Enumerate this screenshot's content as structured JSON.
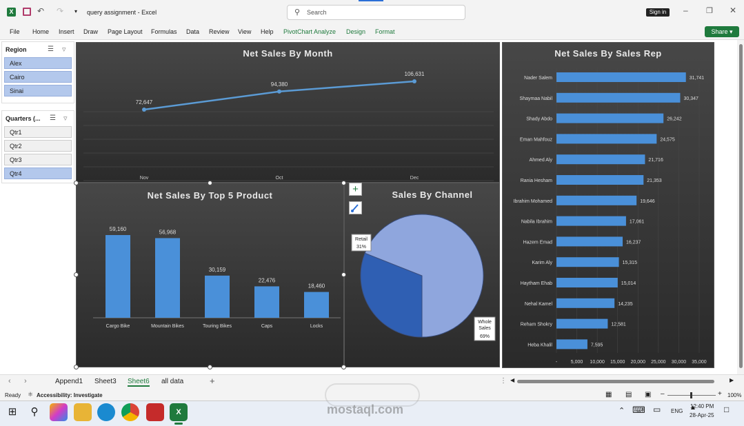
{
  "app": {
    "filename": "query assignment",
    "app_name": "Excel",
    "sep": "-",
    "search_placeholder": "Search",
    "signin": "Sign in"
  },
  "ribbon": {
    "tabs": [
      "File",
      "Home",
      "Insert",
      "Draw",
      "Page Layout",
      "Formulas",
      "Data",
      "Review",
      "View",
      "Help",
      "PivotChart Analyze",
      "Design",
      "Format"
    ],
    "share": "Share"
  },
  "slicers": {
    "region": {
      "title": "Region",
      "items": [
        {
          "label": "Alex",
          "selected": true
        },
        {
          "label": "Cairo",
          "selected": true
        },
        {
          "label": "Sinai",
          "selected": true
        }
      ]
    },
    "quarters": {
      "title": "Quarters (...",
      "items": [
        {
          "label": "Qtr1",
          "selected": false
        },
        {
          "label": "Qtr2",
          "selected": false
        },
        {
          "label": "Qtr3",
          "selected": false
        },
        {
          "label": "Qtr4",
          "selected": true
        }
      ]
    }
  },
  "charts": {
    "month": "Net Sales By Month",
    "product": "Net Sales By Top 5 Product",
    "channel": "Sales By Channel",
    "rep": "Net Sales By Sales Rep"
  },
  "chart_data": [
    {
      "type": "line",
      "title": "Net Sales By Month",
      "categories": [
        "Nov",
        "Oct",
        "Dec"
      ],
      "values": [
        72647,
        94380,
        106631
      ],
      "data_labels": [
        "72,647",
        "94,380",
        "106,631"
      ],
      "color": "#5b9bd5"
    },
    {
      "type": "bar",
      "title": "Net Sales By Top 5 Product",
      "categories": [
        "Cargo Bike",
        "Mountain Bikes",
        "Touring Bikes",
        "Caps",
        "Locks"
      ],
      "values": [
        59160,
        56968,
        30159,
        22476,
        18460
      ],
      "data_labels": [
        "59,160",
        "56,968",
        "30,159",
        "22,476",
        "18,460"
      ],
      "color": "#4a90d9"
    },
    {
      "type": "pie",
      "title": "Sales By Channel",
      "slices": [
        {
          "name": "Retail",
          "pct": "31%",
          "value": 31,
          "color": "#2f5fb3"
        },
        {
          "name": "Whole Sales",
          "pct": "69%",
          "value": 69,
          "color": "#8fa6dd"
        }
      ]
    },
    {
      "type": "bar",
      "orientation": "horizontal",
      "title": "Net Sales By Sales Rep",
      "categories": [
        "Nader Salem",
        "Shaymaa Nabil",
        "Shady Abdo",
        "Eman Mahfouz",
        "Ahmed Aly",
        "Rania Hesham",
        "Ibrahim Mohamed",
        "Nabila Ibrahim",
        "Hazem Emad",
        "Karim Aly",
        "Haytham Ehab",
        "Nehal Kamel",
        "Reham Shokry",
        "Heba Khalil"
      ],
      "values": [
        31741,
        30347,
        26242,
        24575,
        21716,
        21353,
        19646,
        17061,
        16237,
        15315,
        15014,
        14235,
        12581,
        7595
      ],
      "data_labels": [
        "31,741",
        "30,347",
        "26,242",
        "24,575",
        "21,716",
        "21,353",
        "19,646",
        "17,061",
        "16,237",
        "15,315",
        "15,014",
        "14,235",
        "12,581",
        "7,595"
      ],
      "xticks": [
        "-",
        "5,000",
        "10,000",
        "15,000",
        "20,000",
        "25,000",
        "30,000",
        "35,000"
      ],
      "xlim": [
        0,
        35000
      ],
      "color": "#4a90d9"
    }
  ],
  "sheets": {
    "tabs": [
      "Append1",
      "Sheet3",
      "Sheet6",
      "all data"
    ],
    "active": "Sheet6"
  },
  "status": {
    "ready": "Ready",
    "accessibility": "Accessibility: Investigate",
    "zoom": "100%"
  },
  "taskbar": {
    "lang": "ENG",
    "time": "12:40 PM",
    "date": "28-Apr-25"
  },
  "watermark": {
    "text": "mostaql.com"
  }
}
